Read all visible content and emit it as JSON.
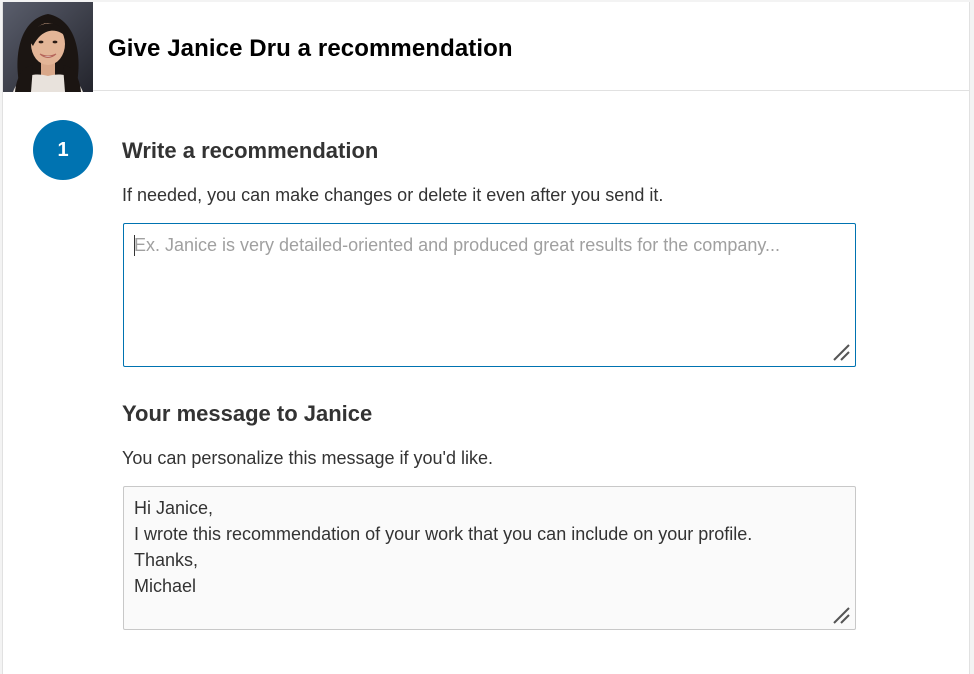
{
  "header": {
    "title": "Give Janice Dru a recommendation",
    "avatar_icon": "person-photo"
  },
  "step": {
    "number": "1"
  },
  "recommendation": {
    "title": "Write a recommendation",
    "subtitle": "If needed, you can make changes or delete it even after you send it.",
    "placeholder": "Ex. Janice is very detailed-oriented and produced great results for the company...",
    "value": ""
  },
  "message": {
    "title": "Your message to Janice",
    "subtitle": "You can personalize this message if you'd like.",
    "value": "Hi Janice,\nI wrote this recommendation of your work that you can include on your profile.\nThanks,\nMichael"
  },
  "colors": {
    "accent": "#0073b1",
    "focus_border": "#0073b1",
    "text": "#333333",
    "placeholder": "#a0a0a0"
  }
}
